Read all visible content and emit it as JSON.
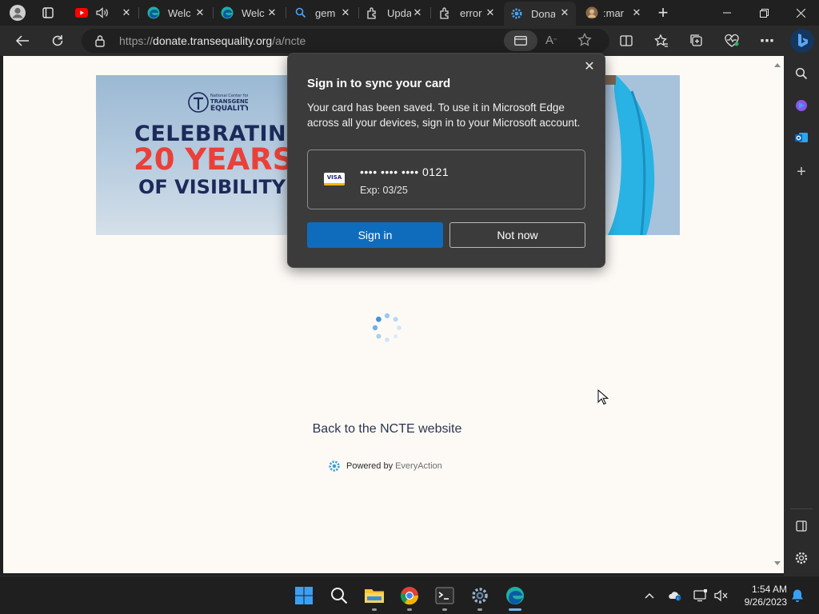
{
  "browser": {
    "tabs": [
      {
        "title": "",
        "favicon": "youtube-icon",
        "audio": true
      },
      {
        "title": "Welc",
        "favicon": "edge-icon"
      },
      {
        "title": "Welc",
        "favicon": "edge-icon"
      },
      {
        "title": "gem",
        "favicon": "search-icon"
      },
      {
        "title": "Upda",
        "favicon": "puzzle-icon"
      },
      {
        "title": "error",
        "favicon": "puzzle-icon"
      },
      {
        "title": "Dona",
        "favicon": "gear-icon",
        "active": true
      },
      {
        "title": ":mar",
        "favicon": "avatar-icon"
      }
    ],
    "url": {
      "scheme": "https://",
      "host": "donate.transequality.org",
      "path": "/a/ncte"
    }
  },
  "page": {
    "banner": {
      "org": "National Center for Transgender Equality",
      "line1": "CELEBRATING",
      "line2": "20 YEARS",
      "line3": "OF VISIBILITY"
    },
    "back_link": "Back to the NCTE website",
    "powered_by": "Powered by",
    "powered_brand": "EveryAction"
  },
  "popup": {
    "title": "Sign in to sync your card",
    "message": "Your card has been saved. To use it in Microsoft Edge across all your devices, sign in to your Microsoft account.",
    "card_brand": "VISA",
    "card_number": "•••• •••• •••• 0121",
    "card_exp": "Exp: 03/25",
    "signin_label": "Sign in",
    "notnow_label": "Not now"
  },
  "taskbar": {
    "time": "1:54 AM",
    "date": "9/26/2023"
  },
  "colors": {
    "accent": "#0f6cbd",
    "banner_red": "#e9413a",
    "banner_navy": "#1c2a5a",
    "flag": "#29b3e4"
  }
}
